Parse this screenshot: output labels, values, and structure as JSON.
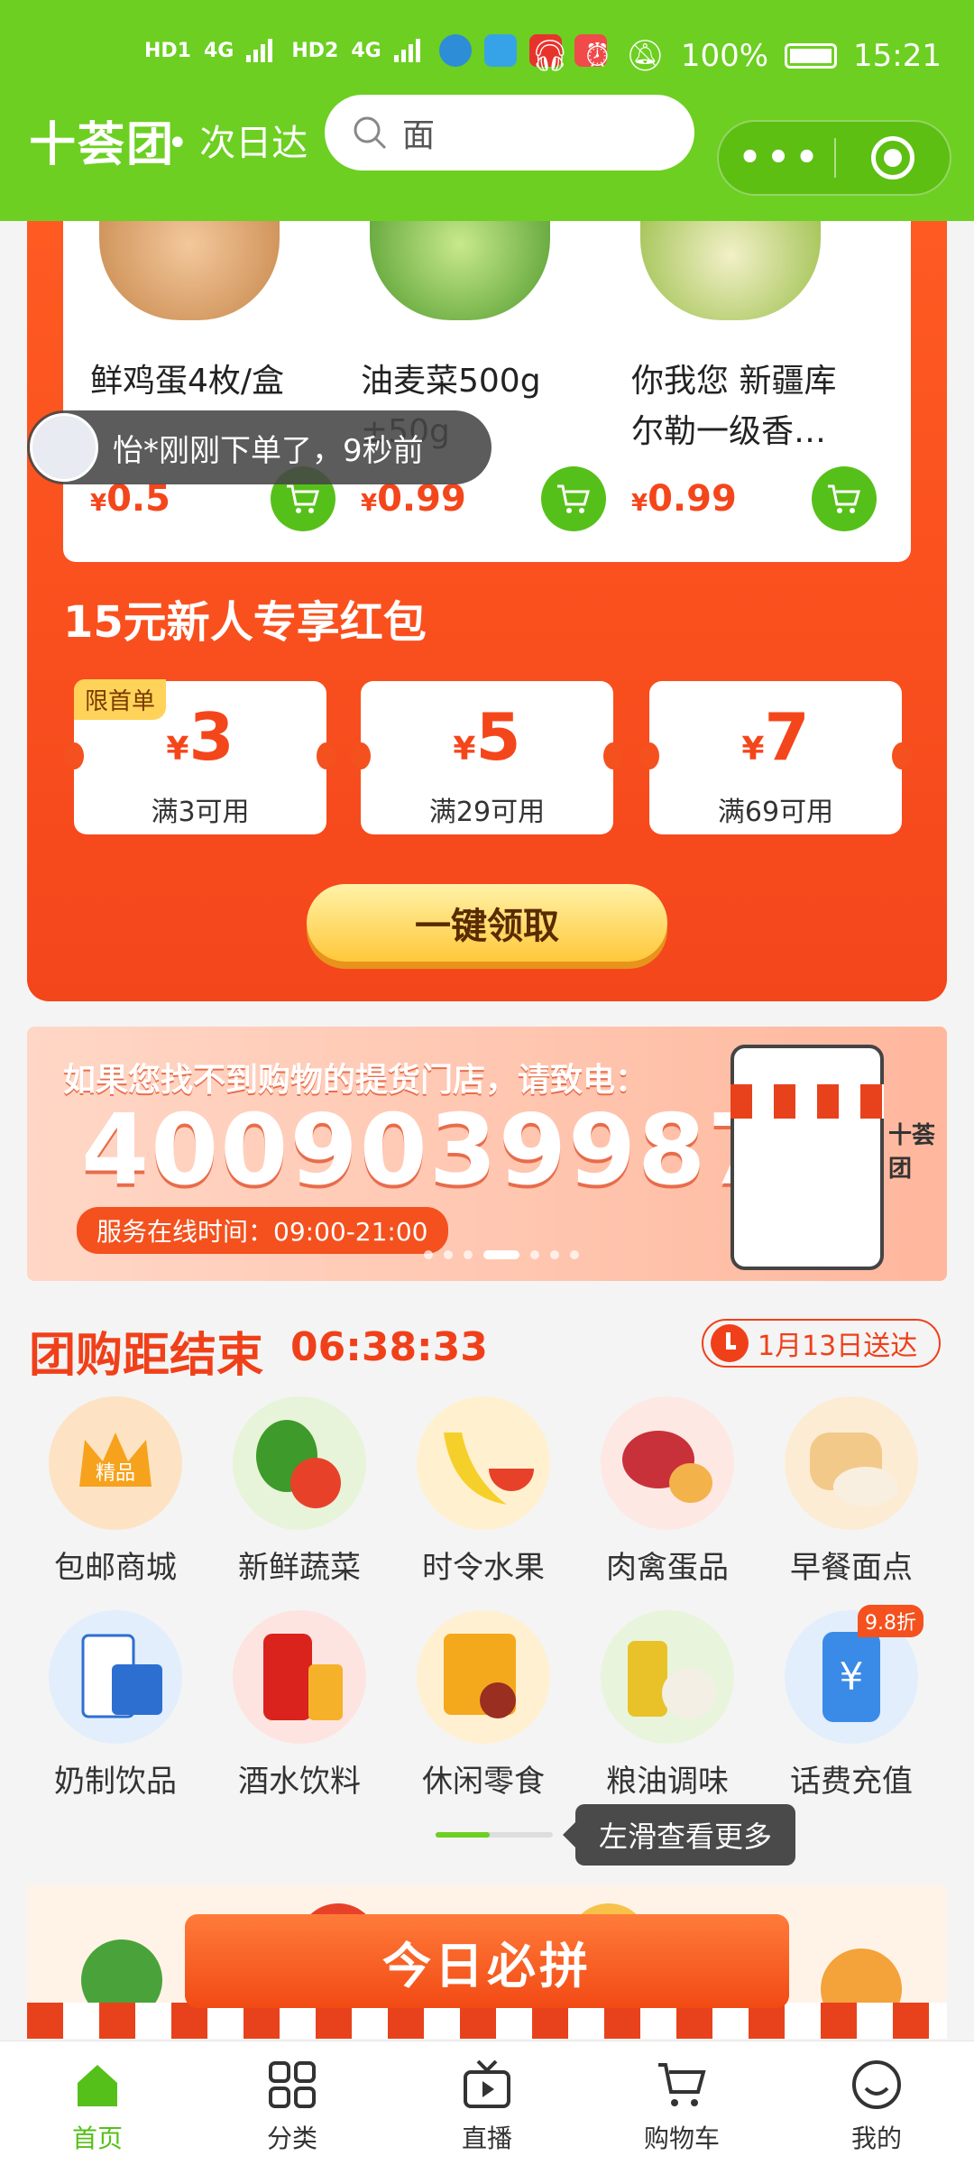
{
  "status_bar": {
    "network_left": [
      "HD1",
      "4G",
      "HD2",
      "4G"
    ],
    "battery": "100%",
    "time": "15:21"
  },
  "header": {
    "logo": "十荟团",
    "logo_sub": "• 次日达",
    "search_query": "面"
  },
  "products": [
    {
      "name": "鲜鸡蛋4枚/盒",
      "price": "0.5",
      "currency": "¥",
      "image": "eggs-basket"
    },
    {
      "name": "油麦菜500g ±50g",
      "price": "0.99",
      "currency": "¥",
      "image": "lettuce"
    },
    {
      "name": "你我您 新疆库尔勒一级香…",
      "price": "0.99",
      "currency": "¥",
      "image": "pears"
    }
  ],
  "toast": {
    "text": "怡*刚刚下单了，9秒前"
  },
  "red_packet": {
    "title": "15元新人专享红包",
    "coupons": [
      {
        "amount": "3",
        "currency": "¥",
        "condition": "满3可用",
        "tag": "限首单"
      },
      {
        "amount": "5",
        "currency": "¥",
        "condition": "满29可用",
        "tag": ""
      },
      {
        "amount": "7",
        "currency": "¥",
        "condition": "满69可用",
        "tag": ""
      }
    ],
    "claim_label": "一键领取"
  },
  "banner": {
    "line1": "如果您找不到购物的提货门店，请致电：",
    "phone": "4009039987",
    "hours": "服务在线时间：09:00-21:00",
    "brand": "十荟团"
  },
  "group_buy": {
    "title": "团购距结束",
    "countdown": "06:38:33",
    "delivery": "1月13日送达"
  },
  "categories": [
    {
      "label": "包邮商城",
      "icon": "crown-icon",
      "icon_text": "精品"
    },
    {
      "label": "新鲜蔬菜",
      "icon": "vegetable-icon"
    },
    {
      "label": "时令水果",
      "icon": "fruit-icon"
    },
    {
      "label": "肉禽蛋品",
      "icon": "meat-icon"
    },
    {
      "label": "早餐面点",
      "icon": "bread-icon"
    },
    {
      "label": "奶制饮品",
      "icon": "milk-icon"
    },
    {
      "label": "酒水饮料",
      "icon": "drink-icon"
    },
    {
      "label": "休闲零食",
      "icon": "snack-icon"
    },
    {
      "label": "粮油调味",
      "icon": "grain-oil-icon"
    },
    {
      "label": "话费充值",
      "icon": "phone-topup-icon",
      "badge": "9.8折"
    }
  ],
  "swipe_tip": "左滑查看更多",
  "today": {
    "title": "今日必拼"
  },
  "tabbar": [
    {
      "label": "首页",
      "icon": "home-icon",
      "active": true
    },
    {
      "label": "分类",
      "icon": "grid-icon",
      "active": false
    },
    {
      "label": "直播",
      "icon": "live-tv-icon",
      "active": false
    },
    {
      "label": "购物车",
      "icon": "cart-icon",
      "active": false
    },
    {
      "label": "我的",
      "icon": "smile-icon",
      "active": false
    }
  ],
  "colors": {
    "brand_green": "#6ccf21",
    "promo_orange": "#f4461b",
    "price_red": "#f4461b"
  }
}
